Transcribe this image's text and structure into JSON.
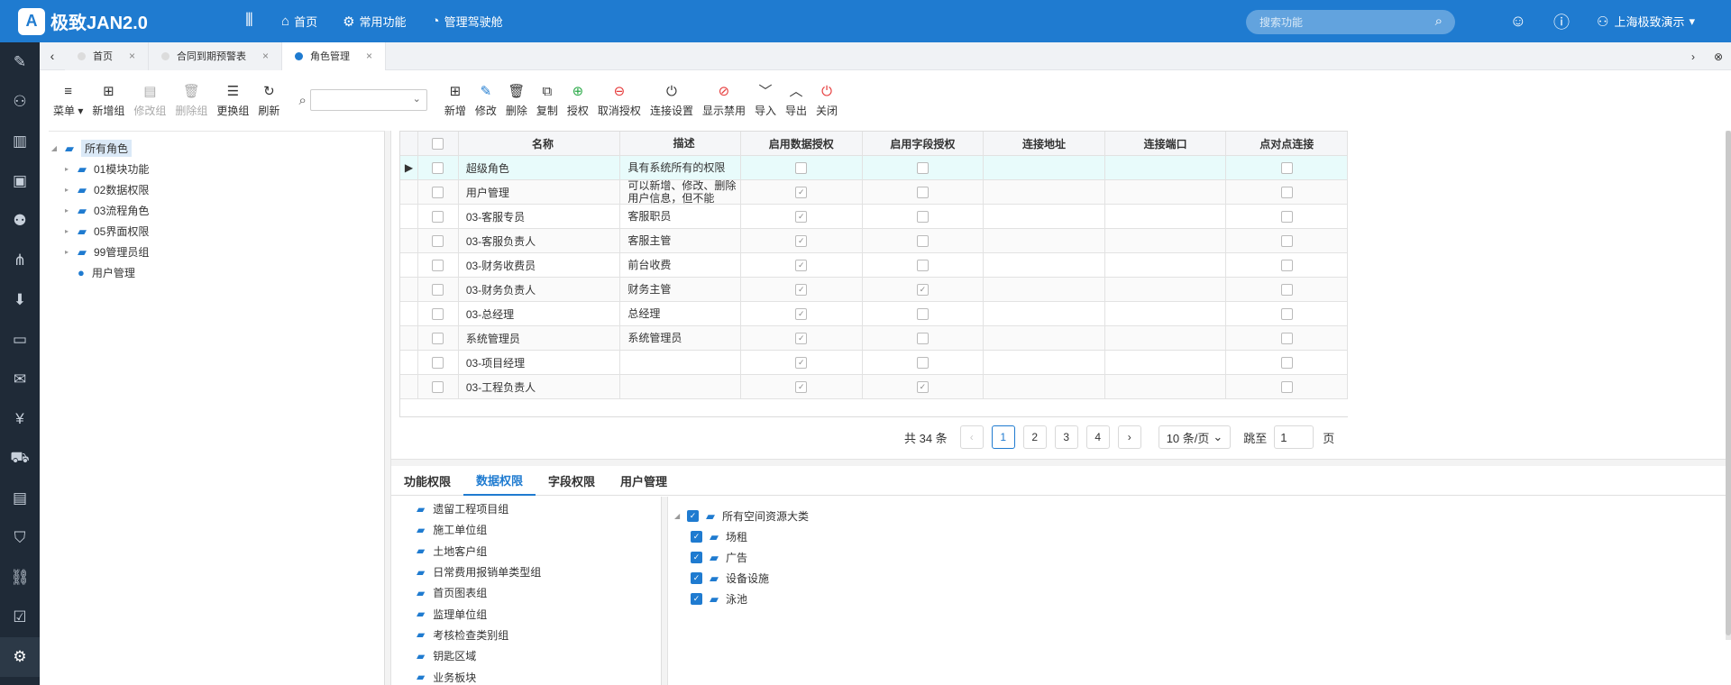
{
  "app": {
    "logo_mark": "A",
    "name": "极致JAN2.0"
  },
  "topnav": [
    {
      "icon": "home-icon",
      "glyph": "⌂",
      "label": "首页"
    },
    {
      "icon": "grid-icon",
      "glyph": "⚙",
      "label": "常用功能"
    },
    {
      "icon": "dashboard-icon",
      "glyph": "◔",
      "label": "管理驾驶舱"
    }
  ],
  "search": {
    "placeholder": "搜索功能"
  },
  "user": {
    "name": "上海极致演示"
  },
  "tabs": [
    {
      "label": "首页",
      "active": false
    },
    {
      "label": "合同到期预警表",
      "active": false
    },
    {
      "label": "角色管理",
      "active": true
    }
  ],
  "toolbar_left": [
    {
      "icon": "menu-icon",
      "glyph": "≡",
      "label": "菜单",
      "disabled": false
    },
    {
      "icon": "add-group-icon",
      "glyph": "⊞",
      "label": "新增组",
      "disabled": false
    },
    {
      "icon": "edit-group-icon",
      "glyph": "▤",
      "label": "修改组",
      "disabled": true
    },
    {
      "icon": "delete-group-icon",
      "glyph": "🗑",
      "label": "删除组",
      "disabled": true
    },
    {
      "icon": "change-group-icon",
      "glyph": "☰",
      "label": "更换组",
      "disabled": false
    },
    {
      "icon": "refresh-icon",
      "glyph": "↻",
      "label": "刷新",
      "disabled": false
    }
  ],
  "toolbar_right": [
    {
      "icon": "add-icon",
      "glyph": "⊞",
      "label": "新增",
      "color": ""
    },
    {
      "icon": "edit-icon",
      "glyph": "✎",
      "label": "修改",
      "color": "blue"
    },
    {
      "icon": "delete-icon",
      "glyph": "🗑",
      "label": "删除",
      "color": ""
    },
    {
      "icon": "copy-icon",
      "glyph": "⧉",
      "label": "复制",
      "color": ""
    },
    {
      "icon": "grant-icon",
      "glyph": "⊕",
      "label": "授权",
      "color": "green"
    },
    {
      "icon": "revoke-icon",
      "glyph": "⊖",
      "label": "取消授权",
      "color": "red"
    },
    {
      "icon": "connect-icon",
      "glyph": "⏻",
      "label": "连接设置",
      "color": ""
    },
    {
      "icon": "ban-icon",
      "glyph": "⊘",
      "label": "显示禁用",
      "color": "red"
    },
    {
      "icon": "import-icon",
      "glyph": "﹀",
      "label": "导入",
      "color": ""
    },
    {
      "icon": "export-icon",
      "glyph": "︿",
      "label": "导出",
      "color": ""
    },
    {
      "icon": "power-icon",
      "glyph": "⏻",
      "label": "关闭",
      "color": "red"
    }
  ],
  "role_tree": {
    "root": "所有角色",
    "children": [
      "01模块功能",
      "02数据权限",
      "03流程角色",
      "05界面权限",
      "99管理员组"
    ],
    "user_node": "用户管理"
  },
  "grid": {
    "columns": [
      "名称",
      "描述",
      "启用数据授权",
      "启用字段授权",
      "连接地址",
      "连接端口",
      "点对点连接"
    ],
    "rows": [
      {
        "name": "超级角色",
        "desc": "具有系统所有的权限",
        "data_auth": false,
        "field_auth": false,
        "p2p": false
      },
      {
        "name": "用户管理",
        "desc": "可以新增、修改、删除用户信息，但不能",
        "data_auth": true,
        "field_auth": false,
        "p2p": false
      },
      {
        "name": "03-客服专员",
        "desc": "客服职员",
        "data_auth": true,
        "field_auth": false,
        "p2p": false
      },
      {
        "name": "03-客服负责人",
        "desc": "客服主管",
        "data_auth": true,
        "field_auth": false,
        "p2p": false
      },
      {
        "name": "03-财务收费员",
        "desc": "前台收费",
        "data_auth": true,
        "field_auth": false,
        "p2p": false
      },
      {
        "name": "03-财务负责人",
        "desc": "财务主管",
        "data_auth": true,
        "field_auth": true,
        "p2p": false
      },
      {
        "name": "03-总经理",
        "desc": "总经理",
        "data_auth": true,
        "field_auth": false,
        "p2p": false
      },
      {
        "name": "系统管理员",
        "desc": "系统管理员",
        "data_auth": true,
        "field_auth": false,
        "p2p": false
      },
      {
        "name": "03-项目经理",
        "desc": "",
        "data_auth": true,
        "field_auth": false,
        "p2p": false
      },
      {
        "name": "03-工程负责人",
        "desc": "",
        "data_auth": true,
        "field_auth": true,
        "p2p": false
      }
    ]
  },
  "pager": {
    "total": "共 34 条",
    "pages": [
      "1",
      "2",
      "3",
      "4"
    ],
    "page_size": "10 条/页",
    "jump_label": "跳至",
    "jump_value": "1",
    "page_unit": "页"
  },
  "perm_tabs": [
    {
      "label": "功能权限",
      "active": false
    },
    {
      "label": "数据权限",
      "active": true
    },
    {
      "label": "字段权限",
      "active": false
    },
    {
      "label": "用户管理",
      "active": false
    }
  ],
  "group_list": [
    "遗留工程项目组",
    "施工单位组",
    "土地客户组",
    "日常费用报销单类型组",
    "首页图表组",
    "监理单位组",
    "考核检查类别组",
    "钥匙区域",
    "业务板块"
  ],
  "resource_tree": {
    "root": "所有空间资源大类",
    "children": [
      "场租",
      "广告",
      "设备设施",
      "泳池"
    ]
  },
  "sidebar_icons": [
    "edit-icon",
    "user-icon",
    "building-icon",
    "document-icon",
    "people-icon",
    "share-icon",
    "inbox-icon",
    "ticket-icon",
    "chat-icon",
    "money-icon",
    "car-icon",
    "report-icon",
    "shield-icon",
    "link-icon",
    "checklist-icon",
    "settings-icon"
  ]
}
